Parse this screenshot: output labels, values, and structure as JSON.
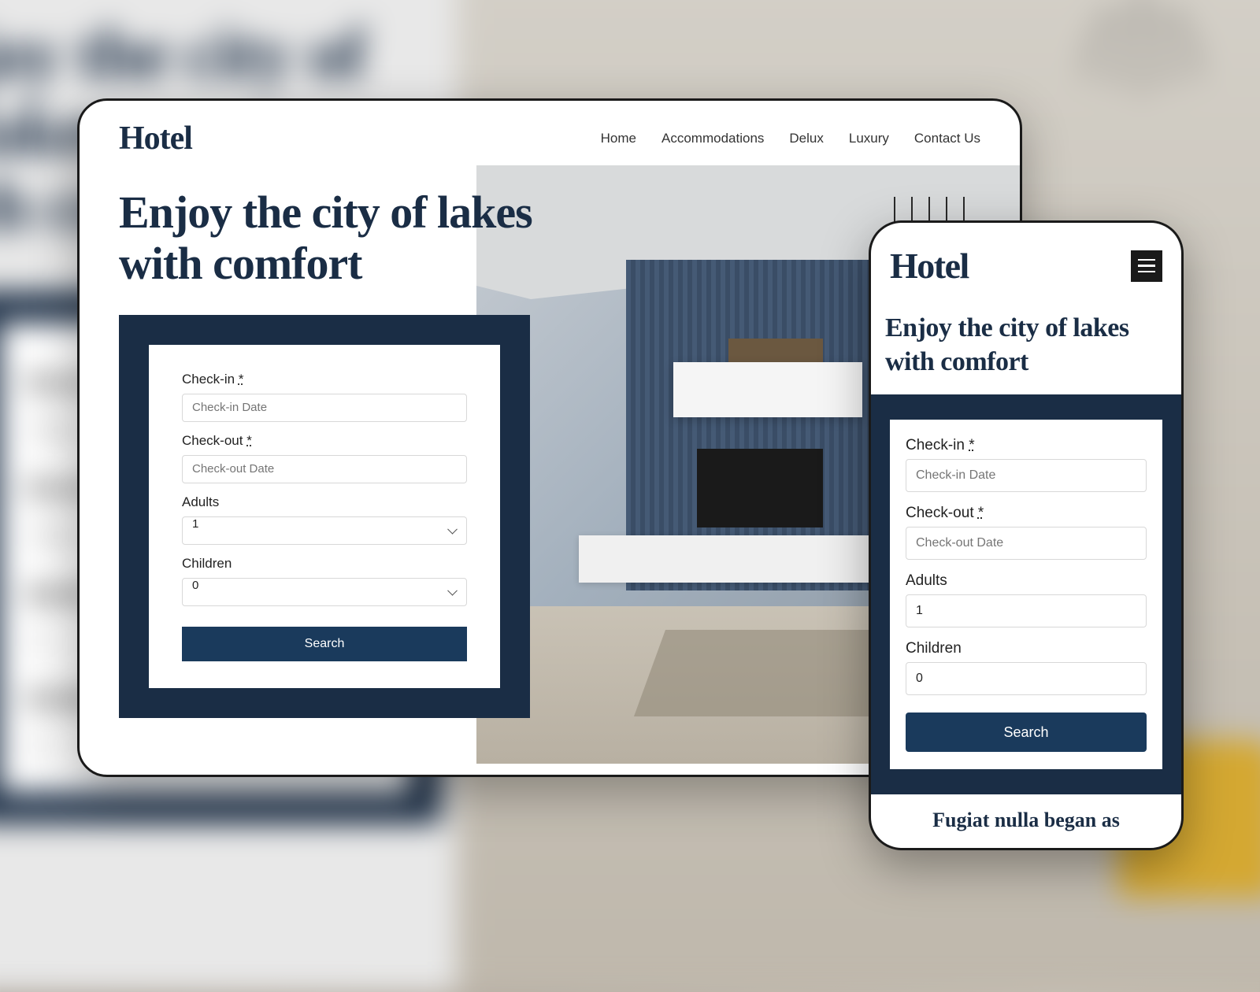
{
  "brand": "Hotel",
  "nav": {
    "items": [
      "Home",
      "Accommodations",
      "Delux",
      "Luxury",
      "Contact Us"
    ]
  },
  "hero": {
    "title_line1": "Enjoy the city of lakes",
    "title_line2": "with comfort"
  },
  "form": {
    "checkin_label": "Check-in ",
    "checkin_req": "*",
    "checkin_placeholder": "Check-in Date",
    "checkout_label": "Check-out ",
    "checkout_req": "*",
    "checkout_placeholder": "Check-out Date",
    "adults_label": "Adults",
    "adults_value": "1",
    "children_label": "Children",
    "children_value": "0",
    "search_label": "Search"
  },
  "mobile": {
    "footer_text": "Fugiat nulla began as"
  },
  "bg": {
    "title": "joy the city of lakes\nth comfort",
    "checkin": "Check-",
    "checkin_val": "Chec",
    "checkout": "Check-",
    "checkout_val": "Chec",
    "adults": "Adults",
    "adults_val": "1",
    "children": "Childre",
    "children_val": "0"
  },
  "colors": {
    "primary": "#1a2d45",
    "button": "#1a3a5c"
  }
}
